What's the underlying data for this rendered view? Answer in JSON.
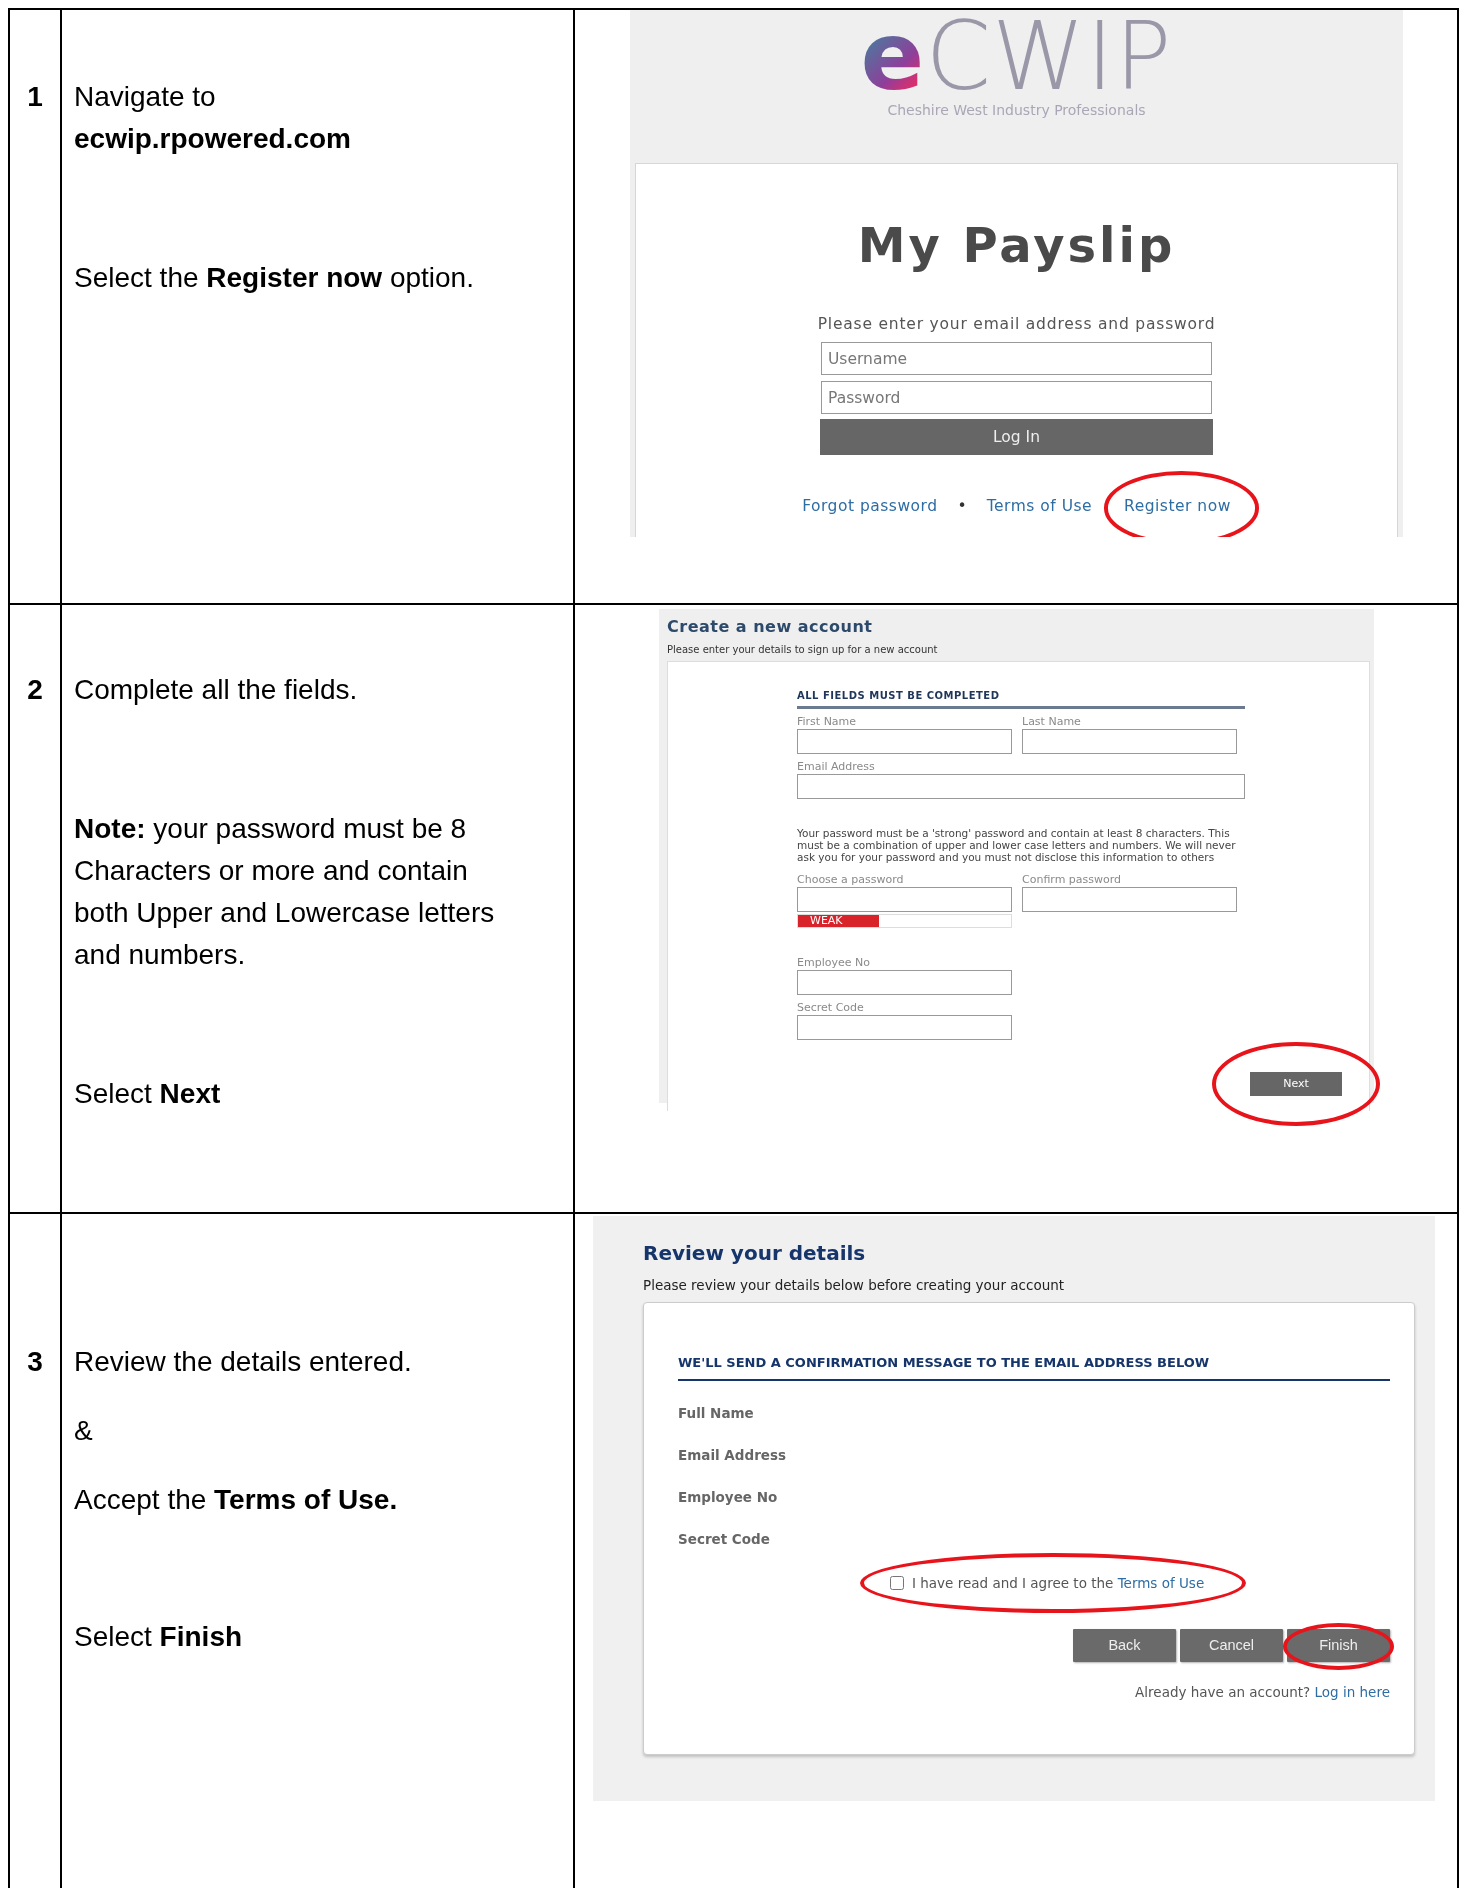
{
  "steps": [
    {
      "number": "1",
      "instructions": [
        [
          "Navigate to",
          "**ecwip.rpowered.com**"
        ],
        [
          "Select the **Register now** option."
        ]
      ],
      "screen": {
        "kind": "login",
        "logo": {
          "mark": "e",
          "wordmark": "CWIP",
          "tagline": "Cheshire West Industry Professionals"
        },
        "title": "My Payslip",
        "prompt": "Please enter your email address and password",
        "fields": [
          {
            "placeholder": "Username"
          },
          {
            "placeholder": "Password"
          }
        ],
        "button": "Log In",
        "links": [
          {
            "kind": "link",
            "text": "Forgot password"
          },
          {
            "kind": "separator",
            "text": "•"
          },
          {
            "kind": "link",
            "text": "Terms of Use"
          },
          {
            "kind": "link",
            "text": "Register now",
            "highlighted": true
          }
        ]
      }
    },
    {
      "number": "2",
      "instructions": [
        [
          "Complete all the fields."
        ],
        [
          "**Note:** your password must be 8",
          "Characters or more and contain",
          "both Upper and Lowercase letters",
          "and numbers."
        ],
        [
          "Select **Next**"
        ]
      ],
      "screen": {
        "kind": "register",
        "title": "Create a new account",
        "subtitle": "Please enter your details to sign up for a new account",
        "heading": "ALL FIELDS MUST BE COMPLETED",
        "rows": [
          {
            "kind": "fields",
            "fields": [
              {
                "label": "First Name"
              },
              {
                "label": "Last Name"
              }
            ]
          },
          {
            "kind": "wide",
            "fields": [
              {
                "label": "Email Address"
              }
            ]
          },
          {
            "kind": "note",
            "text": "Your password must be a 'strong' password and contain at least 8 characters. This must be a combination of upper and lower case letters and numbers. We will never ask you for your password and you must not disclose this information to others"
          },
          {
            "kind": "fields",
            "fields": [
              {
                "label": "Choose a password"
              },
              {
                "label": "Confirm password"
              }
            ],
            "strength": {
              "label": "WEAK",
              "level": 0.38
            }
          },
          {
            "kind": "fields",
            "fields": [
              {
                "label": "Employee No"
              }
            ]
          },
          {
            "kind": "fields",
            "fields": [
              {
                "label": "Secret Code"
              }
            ]
          }
        ],
        "button": {
          "text": "Next",
          "highlighted": true
        }
      }
    },
    {
      "number": "3",
      "instructions": [
        [
          "Review the details entered."
        ],
        [
          "&"
        ],
        [
          "Accept the **Terms of Use.**"
        ],
        [
          "Select **Finish**"
        ]
      ],
      "screen": {
        "kind": "review",
        "title": "Review your details",
        "subtitle": "Please review your details below before creating your account",
        "heading": "WE'LL SEND A CONFIRMATION MESSAGE TO THE EMAIL ADDRESS BELOW",
        "labels": [
          "Full Name",
          "Email Address",
          "Employee No",
          "Secret Code"
        ],
        "agreement": {
          "text": "I have read and I agree to the",
          "link": "Terms of Use",
          "checked": false,
          "highlighted": true
        },
        "buttons": [
          {
            "text": "Back"
          },
          {
            "text": "Cancel"
          },
          {
            "text": "Finish",
            "highlighted": true
          }
        ],
        "footer": {
          "text": "Already have an account?",
          "link": "Log in here"
        }
      }
    }
  ]
}
